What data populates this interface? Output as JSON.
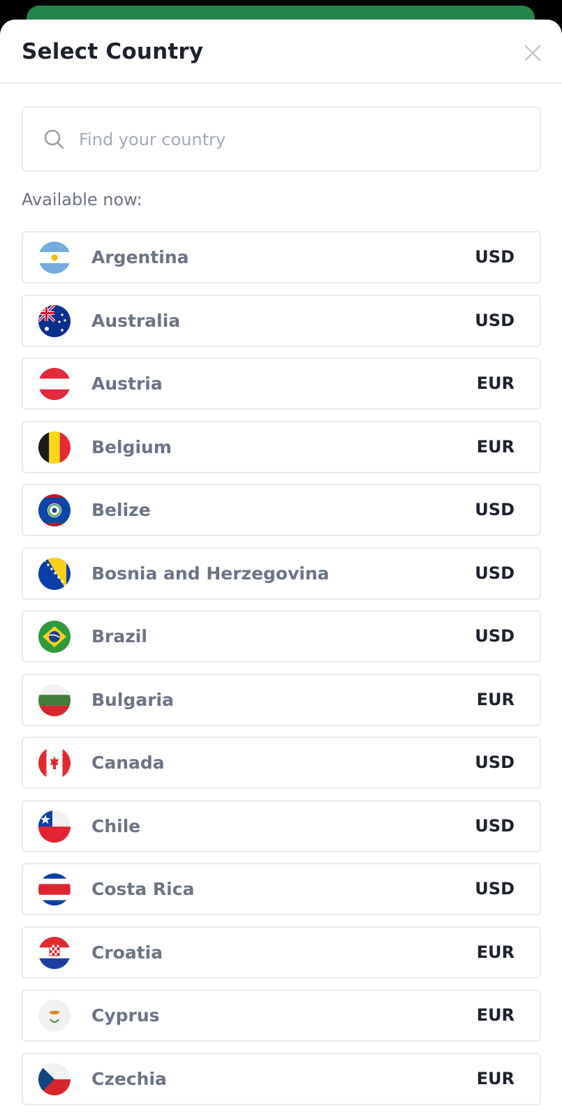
{
  "header": {
    "title": "Select Country"
  },
  "search": {
    "placeholder": "Find your country",
    "value": ""
  },
  "section_label": "Available now:",
  "countries": [
    {
      "name": "Argentina",
      "currency": "USD",
      "flag": "argentina-flag-icon"
    },
    {
      "name": "Australia",
      "currency": "USD",
      "flag": "australia-flag-icon"
    },
    {
      "name": "Austria",
      "currency": "EUR",
      "flag": "austria-flag-icon"
    },
    {
      "name": "Belgium",
      "currency": "EUR",
      "flag": "belgium-flag-icon"
    },
    {
      "name": "Belize",
      "currency": "USD",
      "flag": "belize-flag-icon"
    },
    {
      "name": "Bosnia and Herzegovina",
      "currency": "USD",
      "flag": "bosnia-flag-icon"
    },
    {
      "name": "Brazil",
      "currency": "USD",
      "flag": "brazil-flag-icon"
    },
    {
      "name": "Bulgaria",
      "currency": "EUR",
      "flag": "bulgaria-flag-icon"
    },
    {
      "name": "Canada",
      "currency": "USD",
      "flag": "canada-flag-icon"
    },
    {
      "name": "Chile",
      "currency": "USD",
      "flag": "chile-flag-icon"
    },
    {
      "name": "Costa Rica",
      "currency": "USD",
      "flag": "costa-rica-flag-icon"
    },
    {
      "name": "Croatia",
      "currency": "EUR",
      "flag": "croatia-flag-icon"
    },
    {
      "name": "Cyprus",
      "currency": "EUR",
      "flag": "cyprus-flag-icon"
    },
    {
      "name": "Czechia",
      "currency": "EUR",
      "flag": "czechia-flag-icon"
    }
  ],
  "colors": {
    "accent_bar": "#23854a",
    "title_text": "#1d222b",
    "country_text": "#6c7486",
    "border": "#e8eaee"
  }
}
